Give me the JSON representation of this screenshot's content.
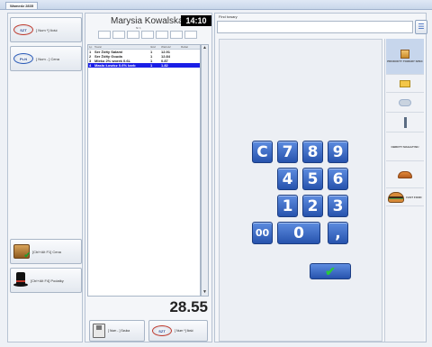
{
  "window": {
    "tab_label": "Wamedz 2835"
  },
  "left": {
    "btn_delete_item": {
      "icon": "SZT",
      "label": "[ Num *] Ilość"
    },
    "btn_price": {
      "icon": "PLN",
      "label": "[ Num - ] Cena"
    },
    "btn_payment": {
      "label": "[Ctrl+Alt F1] Cena"
    },
    "btn_cashier": {
      "label": "[Ctrl+Alt F4] Podatky"
    }
  },
  "center": {
    "cashier_name": "Marysia Kowalska",
    "clock": "14:10",
    "mini_label": "Nr 1",
    "receipt": {
      "headers": [
        "Lp",
        "Towar",
        "Ilość",
        "Wartość",
        "Rabat"
      ],
      "rows": [
        {
          "no": "1",
          "name": "Ser Żółty Salami",
          "qty": "1",
          "value": "12.91",
          "disc": ""
        },
        {
          "no": "2",
          "name": "Ser Żółty Gouda",
          "qty": "1",
          "value": "12.84",
          "disc": ""
        },
        {
          "no": "3",
          "name": "Mleko 2% worek 0.6L",
          "qty": "1",
          "value": "0.87",
          "disc": ""
        },
        {
          "no": "4",
          "name": "Masło Łowicz 0.6% karb",
          "qty": "1",
          "value": "1.82",
          "disc": ""
        }
      ]
    },
    "total": "28.55",
    "btn_save": {
      "label": "[ Num - ] Szuka"
    },
    "btn_qty": {
      "icon": "SZT",
      "label": "[ Num *] Ilość"
    }
  },
  "right": {
    "find_label": "Find towary",
    "find_value": "",
    "numpad": [
      "C",
      "7",
      "8",
      "9",
      "4",
      "5",
      "6",
      "1",
      "2",
      "3",
      "00",
      "0",
      ","
    ],
    "enter_symbol": "✔",
    "categories": [
      {
        "icon": "cards-icon",
        "label": "PRODUKTY TOWARY SPEC"
      },
      {
        "icon": "folder-icon",
        "label": ""
      },
      {
        "icon": "cloud-icon",
        "label": ""
      },
      {
        "icon": "tool-icon",
        "label": ""
      },
      {
        "icon": "bread-icon",
        "label": "OBROTY MAGAZYNU"
      },
      {
        "icon": "burger-icon",
        "label": "FAST FOOD"
      }
    ]
  }
}
